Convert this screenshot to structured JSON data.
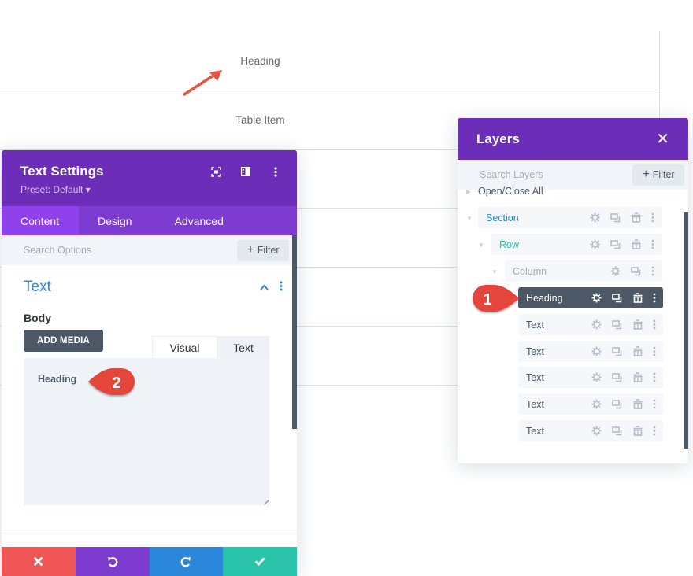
{
  "page": {
    "table_rows": [
      {
        "label": "Heading"
      },
      {
        "label": "Table Item"
      },
      {
        "label": ""
      },
      {
        "label": ""
      },
      {
        "label": ""
      },
      {
        "label": ""
      }
    ]
  },
  "settings": {
    "title": "Text Settings",
    "preset": "Preset: Default ▾",
    "header_icons": [
      "focus-icon",
      "split-view-icon",
      "more-icon"
    ],
    "tabs": [
      {
        "label": "Content",
        "active": true
      },
      {
        "label": "Design",
        "active": false
      },
      {
        "label": "Advanced",
        "active": false
      }
    ],
    "search_placeholder": "Search Options",
    "filter_label": "Filter",
    "toggle_title": "Text",
    "body_label": "Body",
    "add_media_label": "ADD MEDIA",
    "editor_tabs": {
      "visual": "Visual",
      "text": "Text"
    },
    "editor_value": "Heading",
    "footer": {
      "cancel_color": "#ef5555",
      "undo_color": "#7e3bd0",
      "redo_color": "#2b87da",
      "save_color": "#29c4a9"
    }
  },
  "layers": {
    "title": "Layers",
    "search_placeholder": "Search Layers",
    "filter_label": "Filter",
    "open_close_label": "Open/Close All",
    "items": [
      {
        "label": "Section",
        "type": "section",
        "color": "#2b87da"
      },
      {
        "label": "Row",
        "type": "row",
        "color": "#29c4a9"
      },
      {
        "label": "Column",
        "type": "column",
        "color": "#a2acb8"
      },
      {
        "label": "Heading",
        "type": "module",
        "active": true
      },
      {
        "label": "Text",
        "type": "module"
      },
      {
        "label": "Text",
        "type": "module"
      },
      {
        "label": "Text",
        "type": "module"
      },
      {
        "label": "Text",
        "type": "module"
      },
      {
        "label": "Text",
        "type": "module"
      }
    ]
  },
  "annotations": {
    "badge_1": "1",
    "badge_2": "2",
    "badge_color": "#e5463c"
  },
  "colors": {
    "brand_purple": "#6c2eb9",
    "tab_purple": "#7d3bcf",
    "active_tab": "#8f42ec",
    "accent_blue": "#2b87da",
    "dark_slate": "#4c5866"
  }
}
